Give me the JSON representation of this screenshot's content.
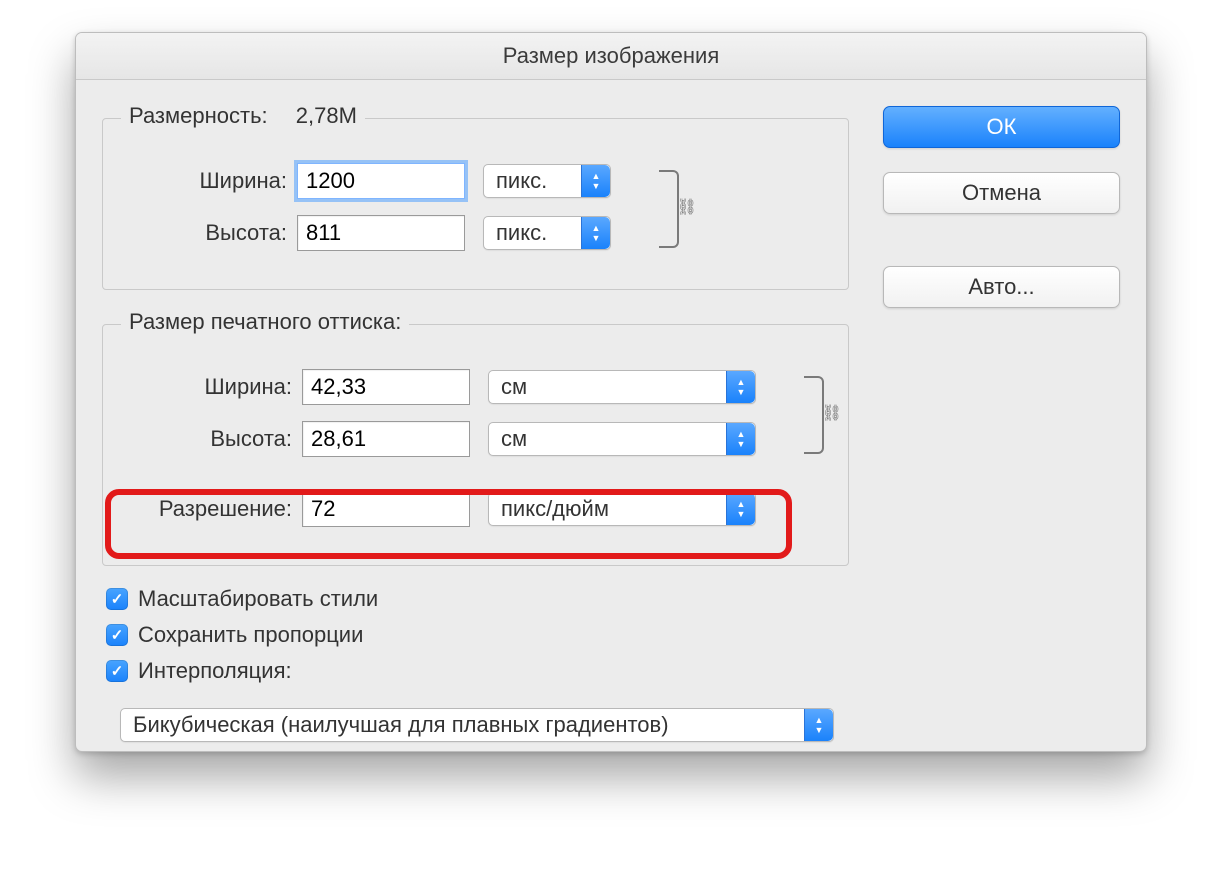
{
  "window": {
    "title": "Размер изображения"
  },
  "pixel_group": {
    "legend_label": "Размерность:",
    "legend_value": "2,78М",
    "width_label": "Ширина:",
    "width_value": "1200",
    "width_unit": "пикс.",
    "height_label": "Высота:",
    "height_value": "811",
    "height_unit": "пикс."
  },
  "print_group": {
    "legend_label": "Размер печатного оттиска:",
    "width_label": "Ширина:",
    "width_value": "42,33",
    "width_unit": "см",
    "height_label": "Высота:",
    "height_value": "28,61",
    "height_unit": "см",
    "resolution_label": "Разрешение:",
    "resolution_value": "72",
    "resolution_unit": "пикс/дюйм"
  },
  "checks": {
    "scale_styles": "Масштабировать стили",
    "constrain": "Сохранить пропорции",
    "resample": "Интерполяция:"
  },
  "interpolation_select": "Бикубическая (наилучшая для плавных градиентов)",
  "buttons": {
    "ok": "ОК",
    "cancel": "Отмена",
    "auto": "Авто..."
  }
}
